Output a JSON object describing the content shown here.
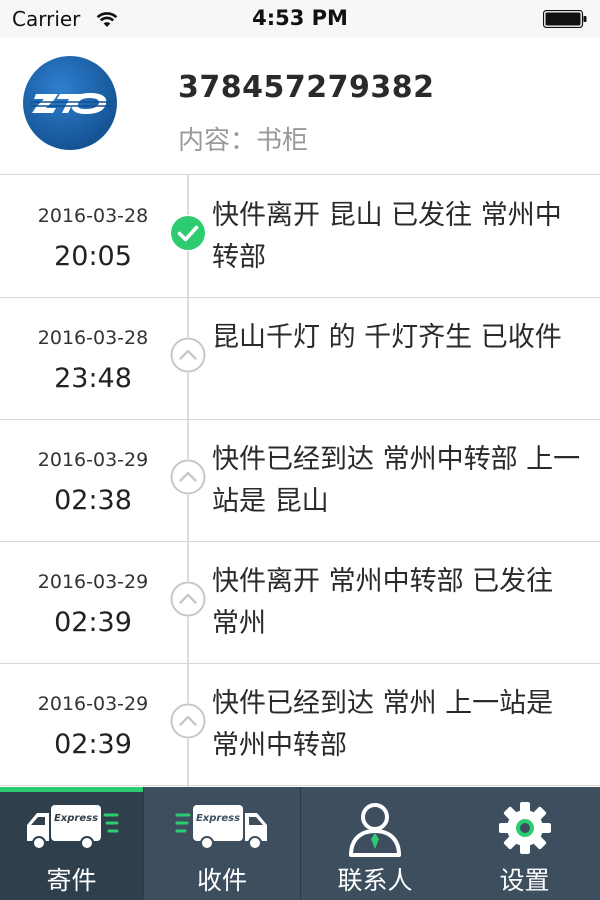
{
  "status_bar": {
    "carrier": "Carrier",
    "time": "4:53 PM",
    "wifi_icon": "wifi-icon",
    "battery_icon": "battery-icon"
  },
  "header": {
    "logo_text": "ZTO",
    "tracking_number": "378457279382",
    "content_label": "内容：",
    "content_value": "书柜"
  },
  "timeline": {
    "events": [
      {
        "date": "2016-03-28",
        "time": "20:05",
        "description": "快件离开 昆山 已发往 常州中转部",
        "status": "current",
        "icon": "check-circle-icon"
      },
      {
        "date": "2016-03-28",
        "time": "23:48",
        "description": "昆山千灯 的 千灯齐生 已收件",
        "status": "past",
        "icon": "chevron-up-circle-icon"
      },
      {
        "date": "2016-03-29",
        "time": "02:38",
        "description": "快件已经到达 常州中转部 上一站是 昆山",
        "status": "past",
        "icon": "chevron-up-circle-icon"
      },
      {
        "date": "2016-03-29",
        "time": "02:39",
        "description": "快件离开 常州中转部 已发往 常州",
        "status": "past",
        "icon": "chevron-up-circle-icon"
      },
      {
        "date": "2016-03-29",
        "time": "02:39",
        "description": "快件已经到达 常州 上一站是 常州中转部",
        "status": "past",
        "icon": "chevron-up-circle-icon"
      }
    ]
  },
  "tab_bar": {
    "tabs": [
      {
        "label": "寄件",
        "icon": "send-truck-icon",
        "badge_text": "Express",
        "active": true
      },
      {
        "label": "收件",
        "icon": "receive-truck-icon",
        "badge_text": "Express",
        "active": false
      },
      {
        "label": "联系人",
        "icon": "contact-person-icon",
        "active": false
      },
      {
        "label": "设置",
        "icon": "gear-icon",
        "active": false
      }
    ]
  },
  "colors": {
    "accent_green": "#2ecc71",
    "tab_bar_bg": "#3d4f5e",
    "logo_blue": "#1a5fa8"
  }
}
